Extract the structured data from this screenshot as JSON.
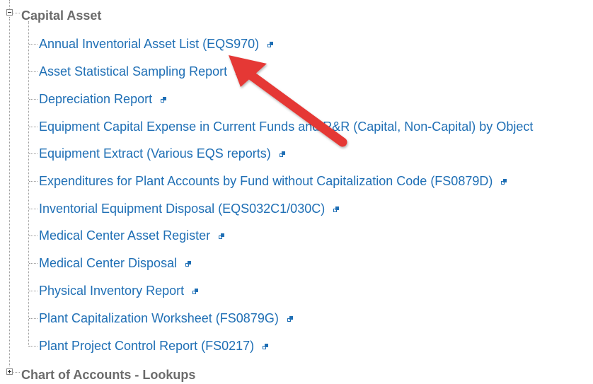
{
  "tree": {
    "capital_asset": {
      "label": "Capital Asset",
      "items": [
        {
          "label": "Annual Inventorial Asset List (EQS970)"
        },
        {
          "label": "Asset Statistical Sampling Report"
        },
        {
          "label": "Depreciation Report"
        },
        {
          "label": "Equipment Capital Expense in Current Funds and R&R (Capital, Non-Capital) by Object"
        },
        {
          "label": "Equipment Extract (Various EQS reports)"
        },
        {
          "label": "Expenditures for Plant Accounts by Fund without Capitalization Code (FS0879D)"
        },
        {
          "label": "Inventorial Equipment Disposal (EQS032C1/030C)"
        },
        {
          "label": "Medical Center Asset Register"
        },
        {
          "label": "Medical Center Disposal"
        },
        {
          "label": "Physical Inventory Report"
        },
        {
          "label": "Plant Capitalization Worksheet (FS0879G)"
        },
        {
          "label": "Plant Project Control Report (FS0217)"
        }
      ]
    },
    "chart_of_accounts": {
      "label": "Chart of Accounts - Lookups"
    }
  },
  "annotation": {
    "color": "#e53935",
    "type": "arrow"
  }
}
